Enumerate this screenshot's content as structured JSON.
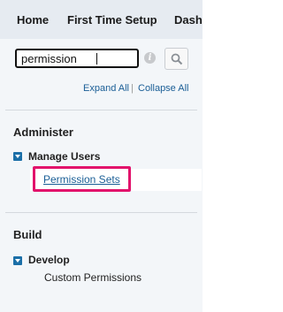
{
  "topnav": {
    "tabs": [
      "Home",
      "First Time Setup",
      "Dash"
    ]
  },
  "search": {
    "value": "permission"
  },
  "sidebar": {
    "expand_all": "Expand All",
    "separator": "|",
    "collapse_all": "Collapse All",
    "sections": [
      {
        "title": "Administer",
        "node": "Manage Users",
        "children": [
          "Permission Sets"
        ]
      },
      {
        "title": "Build",
        "node": "Develop",
        "children": [
          "Custom Permissions"
        ]
      }
    ]
  },
  "colors": {
    "highlight_border": "#e2126b",
    "link": "#1a5e96",
    "toggle": "#1b6fa8"
  },
  "icons": {
    "info": "info-icon",
    "search": "magnifier-icon",
    "expand": "triangle-down-icon"
  }
}
